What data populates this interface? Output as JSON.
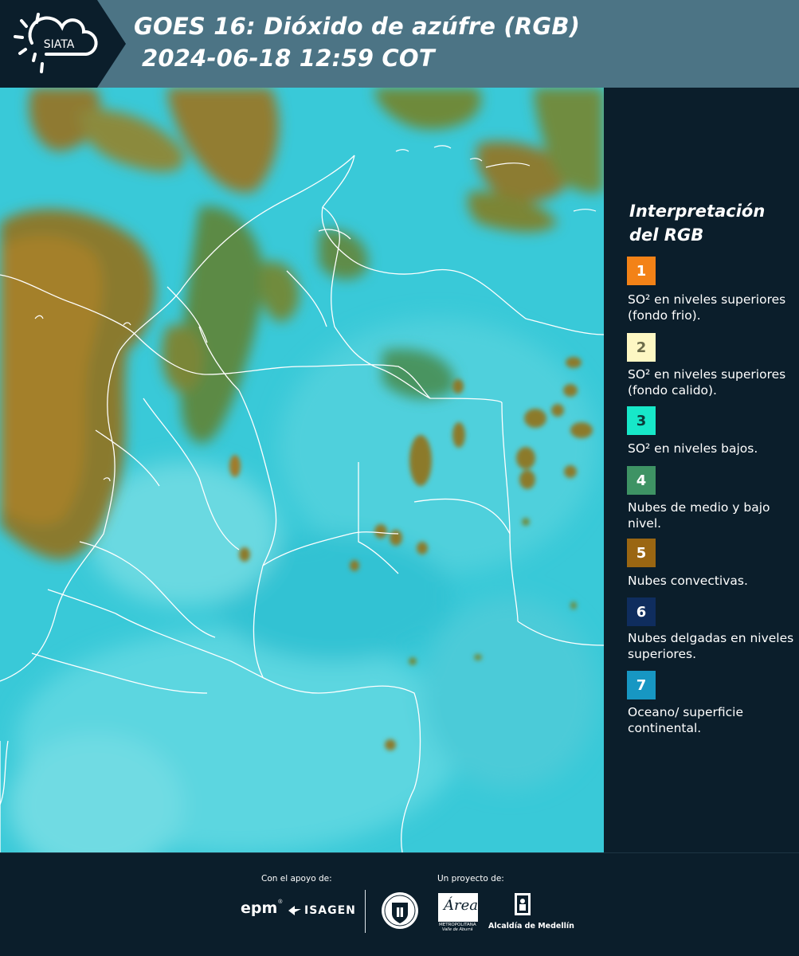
{
  "header": {
    "logo_text": "SIATA",
    "title_line1": "GOES 16: Dióxido de azúfre (RGB)",
    "title_line2": "2024-06-18 12:59 COT"
  },
  "legend": {
    "title_line1": "Interpretación",
    "title_line2": "del RGB",
    "items": [
      {
        "number": "1",
        "color": "#f38217",
        "text_color": "#ffffff",
        "description": "SO² en niveles superiores (fondo frio)."
      },
      {
        "number": "2",
        "color": "#fdf7c3",
        "text_color": "#6b6b4a",
        "description": "SO² en niveles superiores (fondo calido)."
      },
      {
        "number": "3",
        "color": "#17e8c9",
        "text_color": "#0b3c3a",
        "description": "SO² en niveles bajos."
      },
      {
        "number": "4",
        "color": "#3e9364",
        "text_color": "#ffffff",
        "description": "Nubes de medio y bajo nivel."
      },
      {
        "number": "5",
        "color": "#9a6612",
        "text_color": "#ffffff",
        "description": "Nubes convectivas."
      },
      {
        "number": "6",
        "color": "#0f2d5e",
        "text_color": "#ffffff",
        "description": "Nubes delgadas en niveles superiores."
      },
      {
        "number": "7",
        "color": "#1797c3",
        "text_color": "#ffffff",
        "description": "Oceano/ superficie continental."
      }
    ]
  },
  "footer": {
    "support_label": "Con el apoyo de:",
    "project_label": "Un proyecto de:",
    "epm": "epm",
    "isagen": "ISAGEN",
    "area_name": "Área",
    "area_sub1": "METROPOLITANA",
    "area_sub2": "Valle de Aburrá",
    "alcaldia": "Alcaldía de Medellín"
  },
  "map": {
    "type": "satellite RGB composite"
  }
}
